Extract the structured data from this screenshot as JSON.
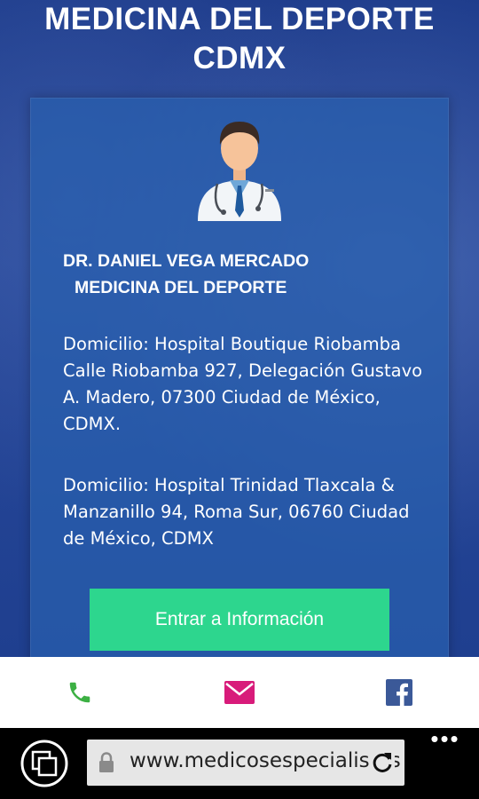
{
  "site": {
    "title_line1": "MEDICINA DEL DEPORTE",
    "title_line2": "CDMX"
  },
  "card": {
    "doctor_name": "DR. DANIEL VEGA MERCADO",
    "specialty": "MEDICINA DEL DEPORTE",
    "addresses": [
      "Domicilio: Hospital Boutique Riobamba Calle Riobamba 927, Delegación Gustavo A. Madero, 07300 Ciudad de México, CDMX.",
      "Domicilio: Hospital Trinidad Tlaxcala & Manzanillo 94, Roma Sur, 06760 Ciudad de México, CDMX"
    ],
    "button_label": "Entrar a Información",
    "button_color": "#2dd68e"
  },
  "action_bar": {
    "items": [
      {
        "icon": "phone-icon",
        "color": "#3cb043"
      },
      {
        "icon": "mail-icon",
        "color": "#d81b7a"
      },
      {
        "icon": "facebook-icon",
        "color": "#3b5998"
      }
    ]
  },
  "browser": {
    "url": "www.medicosespecialistas",
    "icons": [
      "tabs-icon",
      "lock-icon",
      "refresh-icon",
      "more-icon"
    ],
    "more_label": "•••"
  }
}
